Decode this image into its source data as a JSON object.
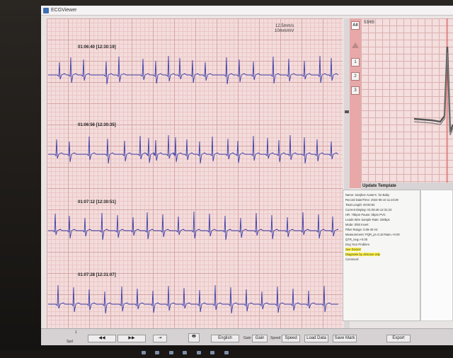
{
  "window": {
    "title": "ECGViewer"
  },
  "strips": {
    "gain_label_1": "12.5mm/s",
    "gain_label_2": "10mm/mV",
    "rows": [
      {
        "time": "01:06:40 [12:30:19]"
      },
      {
        "time": "01:06:56 [12:30:35]"
      },
      {
        "time": "01:07:12 [12:30:51]"
      },
      {
        "time": "01:07:28 [12:31:07]"
      }
    ]
  },
  "beat_panel": {
    "all_label": "All",
    "buttons": [
      "1",
      "2",
      "3"
    ]
  },
  "template": {
    "counter": "53/65",
    "update_label": "Update Template"
  },
  "info": {
    "rows": [
      "Name: Sanjhee          Avast K. for Baby",
      "Record Date/Time: 2024-05-10  11:23:39",
      "Total Length: 00:00:52",
      "Current Display: 01:06:40-12:31:23",
      "HR: 70bpm          Pause: 0bpm  PVC",
      "Leads Wire          Sample Rate: 250bps",
      "Mode: 0/50          Invert",
      "Filter Range: 0.05-40 Hz",
      "Measurement: PQR_pr=0.18 Rate=+0.00",
      "         QTR_neg=+0.00",
      "Dog Your Problem",
      "See Doctor!",
      "Diagnosis by clinician only",
      "Comment:"
    ],
    "highlight_rows": [
      11,
      12
    ]
  },
  "toolbar": {
    "page_label": "1",
    "spd_label": "Spd",
    "prev_label": "◀◀",
    "next_label": "▶▶",
    "exit_label": "⇥",
    "print_label": "🖶",
    "lang_value": "English",
    "gain_label": "Gain",
    "gain_value": "Gain",
    "speed_label": "Speed",
    "speed_value": "Speed",
    "btn1": "Load Data",
    "btn2": "Save Mark",
    "btn3": "Export"
  },
  "colors": {
    "trace": "#3b3ea8",
    "grid_major": "#d7a6a6",
    "highlight": "#fff64a"
  }
}
